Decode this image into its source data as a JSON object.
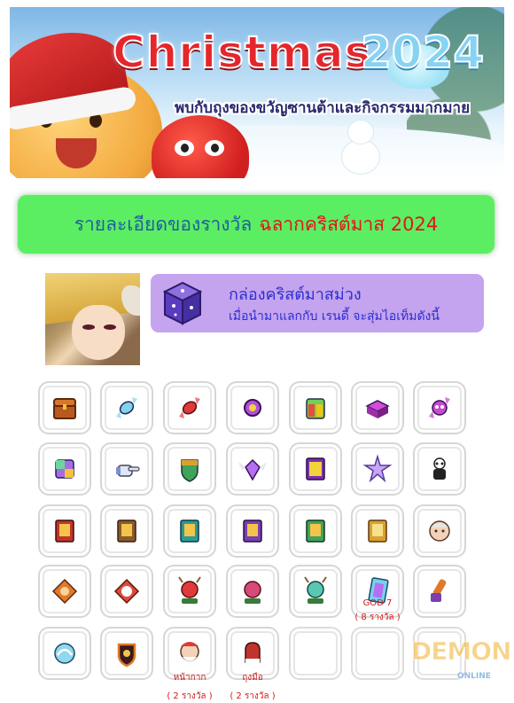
{
  "banner": {
    "title_main": "Christmas",
    "title_year": "2024",
    "tagline": "พบกับถุงของขวัญซานต้าและกิจกรรมมากมาย"
  },
  "heading": {
    "text_main": "รายละเอียดของรางวัล",
    "text_highlight": "ฉลากคริสต์มาส 2024"
  },
  "item": {
    "name": "กล่องคริสต์มาสม่วง",
    "description": "เมื่อนำมาแลกกับ เรนดี้ จะสุ่มไอเท็มดังนี้"
  },
  "rewards": [
    [
      {
        "icon": "treasure-chest-icon",
        "caption": []
      },
      {
        "icon": "candy-blue-icon",
        "caption": []
      },
      {
        "icon": "candy-red-icon",
        "caption": []
      },
      {
        "icon": "purple-orb-icon",
        "caption": []
      },
      {
        "icon": "potion-set-icon",
        "caption": []
      },
      {
        "icon": "gift-box-purple-icon",
        "caption": []
      },
      {
        "icon": "skull-candy-icon",
        "caption": []
      }
    ],
    [
      {
        "icon": "rainbow-box-icon",
        "caption": []
      },
      {
        "icon": "pointing-glove-icon",
        "caption": []
      },
      {
        "icon": "green-shield-icon",
        "caption": []
      },
      {
        "icon": "winged-gem-icon",
        "caption": []
      },
      {
        "icon": "exp-card-icon",
        "caption": []
      },
      {
        "icon": "crystal-star-icon",
        "caption": []
      },
      {
        "icon": "panda-costume-icon",
        "caption": []
      }
    ],
    [
      {
        "icon": "red-book-icon",
        "caption": []
      },
      {
        "icon": "brown-book-icon",
        "caption": []
      },
      {
        "icon": "teal-book-icon",
        "caption": []
      },
      {
        "icon": "purple-book-icon",
        "caption": []
      },
      {
        "icon": "green-book-icon",
        "caption": []
      },
      {
        "icon": "gold-book-icon",
        "caption": []
      },
      {
        "icon": "elder-face-icon",
        "caption": []
      }
    ],
    [
      {
        "icon": "orange-diamond-badge-icon",
        "caption": []
      },
      {
        "icon": "white-diamond-badge-icon",
        "caption": []
      },
      {
        "icon": "reindeer-hat-2024-icon",
        "caption": []
      },
      {
        "icon": "santa-hat-2024-icon",
        "caption": []
      },
      {
        "icon": "green-hat-2024-icon",
        "caption": []
      },
      {
        "icon": "god-card-icon",
        "caption": [
          "GOD 7",
          "( 8 รางวัล )"
        ]
      },
      {
        "icon": "rainbow-bat-icon",
        "caption": []
      }
    ],
    [
      {
        "icon": "blue-dragon-orb-icon",
        "caption": []
      },
      {
        "icon": "fire-shield-icon",
        "caption": []
      },
      {
        "icon": "santa-mask-icon",
        "caption": [
          "หน้ากาก",
          "( 2 รางวัล )"
        ]
      },
      {
        "icon": "red-mitten-icon",
        "caption": [
          "ถุงมือ",
          "( 2 รางวัล )"
        ]
      },
      {
        "icon": "",
        "caption": []
      },
      {
        "icon": "",
        "caption": []
      },
      {
        "icon": "",
        "caption": []
      }
    ]
  ],
  "watermark": {
    "logo_text": "DEMON",
    "logo_sub": "ONLINE"
  },
  "colors": {
    "heading_bg": "#5cee62",
    "heading_text": "#215f9e",
    "heading_highlight": "#e0161b",
    "info_bg": "#c4a3ef",
    "info_text": "#2b2fd0",
    "caption_red": "#d61818"
  }
}
